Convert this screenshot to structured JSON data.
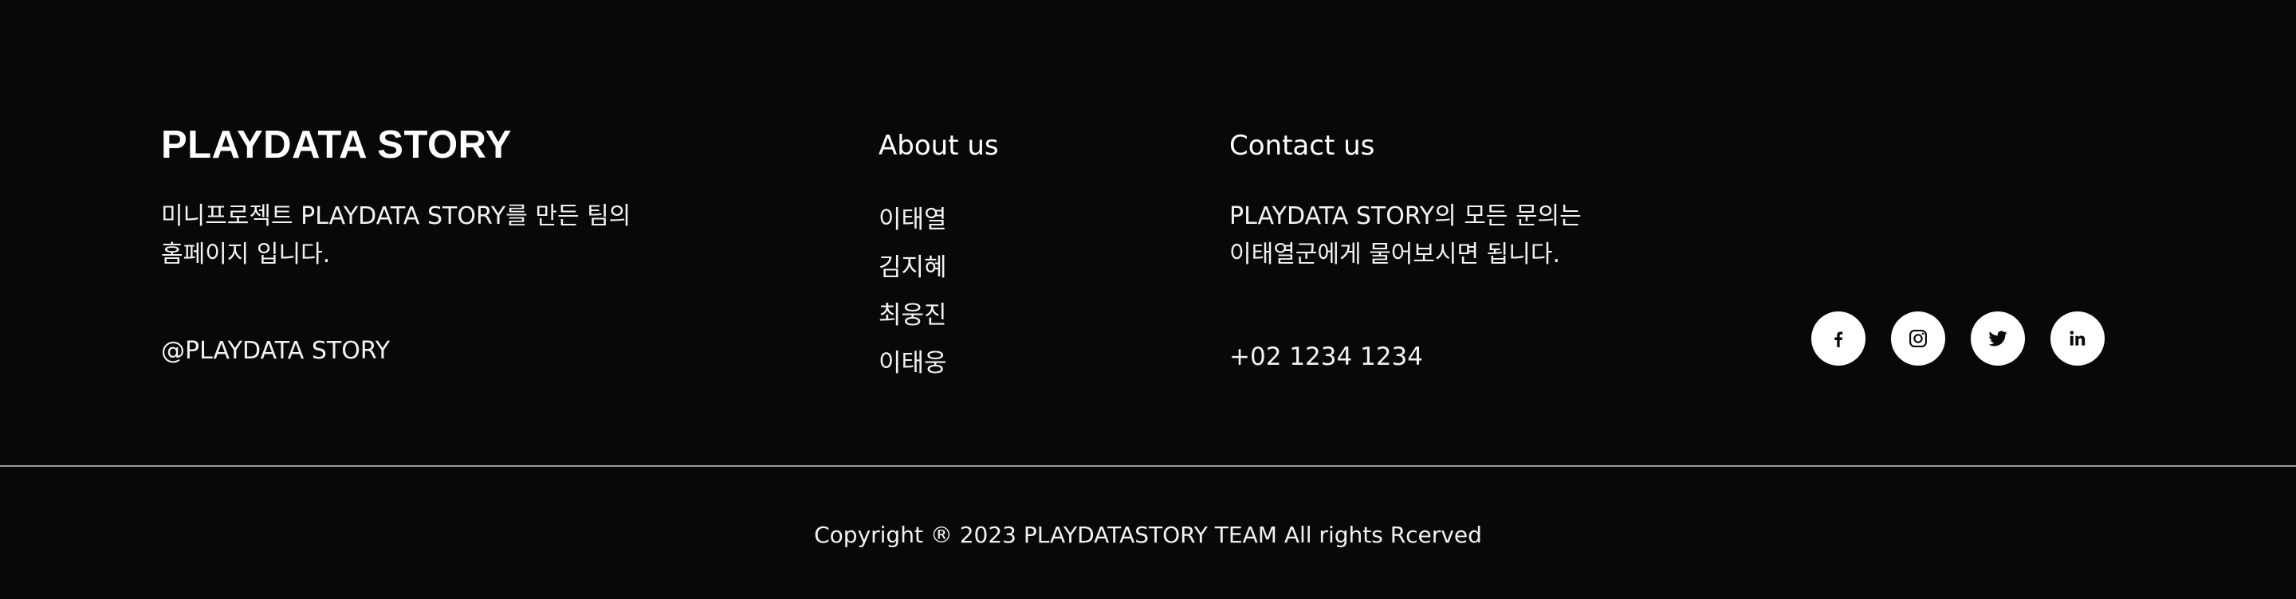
{
  "brand": {
    "title": "PLAYDATA STORY",
    "description_line1": "미니프로젝트 PLAYDATA STORY를 만든 팀의",
    "description_line2": "홈페이지 입니다.",
    "handle": "@PLAYDATA STORY"
  },
  "about": {
    "heading": "About us",
    "members": [
      "이태열",
      "김지혜",
      "최웅진",
      "이태웅"
    ]
  },
  "contact": {
    "heading": "Contact us",
    "description_line1": "PLAYDATA STORY의 모든 문의는",
    "description_line2": "이태열군에게 물어보시면 됩니다.",
    "phone": "+02 1234 1234"
  },
  "social": [
    {
      "icon": "facebook-icon"
    },
    {
      "icon": "instagram-icon"
    },
    {
      "icon": "twitter-icon"
    },
    {
      "icon": "linkedin-icon"
    }
  ],
  "colors": {
    "background": "#080808",
    "text": "#ffffff",
    "divider": "#9a9a9a",
    "icon_bg": "#ffffff",
    "icon_fg": "#080808"
  },
  "copyright": "Copyright ® 2023 PLAYDATASTORY TEAM All rights Rcerved"
}
